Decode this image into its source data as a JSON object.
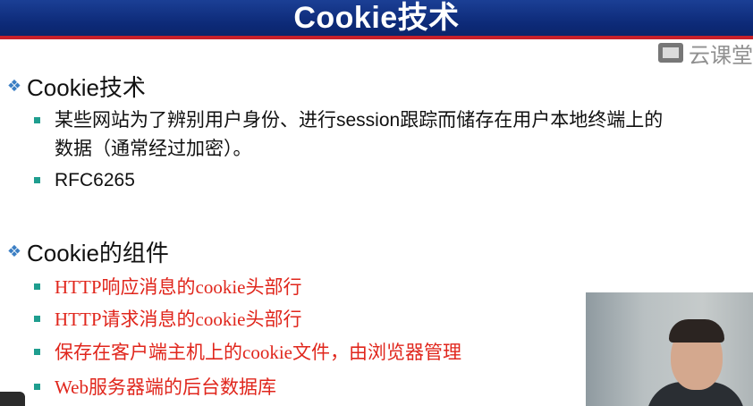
{
  "slide": {
    "title": "Cookie技术",
    "brand": "云课堂",
    "sections": [
      {
        "heading": "Cookie技术",
        "items": [
          {
            "line1": "某些网站为了辨别用户身份、进行session跟踪而储存在用户本地终端上的",
            "line2": "数据（通常经过加密）。"
          },
          {
            "line1": "RFC6265"
          }
        ]
      },
      {
        "heading": "Cookie的组件",
        "items": [
          {
            "line1": "HTTP响应消息的cookie头部行"
          },
          {
            "line1": "HTTP请求消息的cookie头部行"
          },
          {
            "line1": "保存在客户端主机上的cookie文件，由浏览器管理"
          },
          {
            "line1": "Web服务器端的后台数据库"
          }
        ]
      }
    ]
  },
  "colors": {
    "title_bg": "#0d2a78",
    "accent_red": "#c8202a",
    "bullet_teal": "#1f9e8f",
    "diamond_blue": "#3b7fc4",
    "item_red": "#e0261c"
  }
}
